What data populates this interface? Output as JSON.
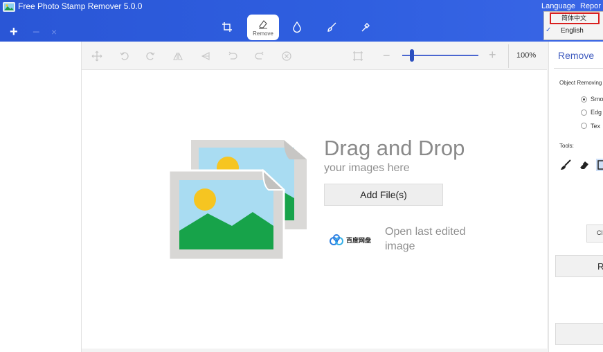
{
  "app": {
    "title": "Free Photo Stamp Remover 5.0.0",
    "menu_language": "Language",
    "menu_report": "Repor",
    "colors": {
      "titlebar": "#2f5fe0",
      "accent": "#3f5bbf",
      "highlight": "#d9201f"
    }
  },
  "language_menu": {
    "options": [
      {
        "label": "简体中文",
        "highlighted": true
      },
      {
        "label": "English",
        "checked": true
      }
    ],
    "check_glyph": "✓"
  },
  "tabbar": {
    "new_glyph": "+",
    "minus_glyph": "−",
    "close_glyph": "×",
    "tabs": [
      {
        "name": "crop-icon"
      },
      {
        "name": "remove-icon",
        "label": "Remove",
        "active": true
      },
      {
        "name": "drop-icon"
      },
      {
        "name": "brush-icon"
      },
      {
        "name": "wand-icon"
      }
    ]
  },
  "toolbar": {
    "icons": [
      "move-icon",
      "rotate-left-icon",
      "rotate-right-icon",
      "flip-horizontal-icon",
      "flip-vertical-icon",
      "undo-icon",
      "redo-icon",
      "cancel-icon",
      "crop-frame-icon"
    ],
    "zoom_minus": "−",
    "zoom_plus": "+",
    "zoom_level": "100%"
  },
  "canvas": {
    "drag_title": "Drag and Drop",
    "drag_subtitle": "your images here",
    "add_files_label": "Add File(s)",
    "open_last_label": "Open last edited image",
    "watermark_text": "百度网盘"
  },
  "right_panel": {
    "title": "Remove",
    "object_removing_label": "Object Removing",
    "radio_options": [
      {
        "label": "Smo",
        "selected": true
      },
      {
        "label": "Edg",
        "selected": false
      },
      {
        "label": "Tex",
        "selected": false
      }
    ],
    "tools_label": "Tools:",
    "tools": [
      "brush-tool-icon",
      "eraser-tool-icon",
      "rect-select-tool-icon"
    ],
    "button_small_label": "Cl",
    "button_run_label": "R",
    "button_bottom_label": ""
  }
}
